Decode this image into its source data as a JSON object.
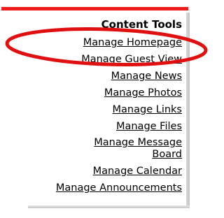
{
  "panel": {
    "heading": "Content Tools",
    "links": [
      {
        "label": "Manage Homepage"
      },
      {
        "label": "Manage Guest View"
      },
      {
        "label": "Manage News"
      },
      {
        "label": "Manage Photos"
      },
      {
        "label": "Manage Links"
      },
      {
        "label": "Manage Files"
      },
      {
        "label": "Manage Message Board"
      },
      {
        "label": "Manage Calendar"
      },
      {
        "label": "Manage Announcements"
      }
    ]
  },
  "colors": {
    "accent": "#ee1c1c",
    "highlight_oval": "#e01010",
    "text": "#000000"
  }
}
